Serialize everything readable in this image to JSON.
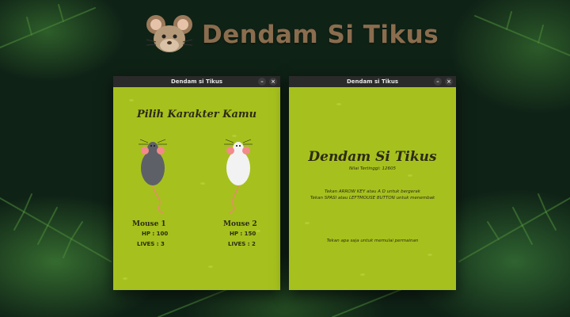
{
  "header": {
    "title": "Dendam Si Tikus",
    "logo": "mouse-head-icon"
  },
  "left_window": {
    "title": "Dendam si Tikus",
    "minimize_glyph": "–",
    "close_glyph": "×",
    "heading": "Pilih Karakter Kamu",
    "characters": [
      {
        "name": "Mouse 1",
        "hp": "HP : 100",
        "lives": "LIVES : 3",
        "body_color": "#5e6068"
      },
      {
        "name": "Mouse 2",
        "hp": "HP : 150",
        "lives": "LIVES : 2",
        "body_color": "#f2f2f2"
      }
    ]
  },
  "right_window": {
    "title": "Dendam si Tikus",
    "minimize_glyph": "–",
    "close_glyph": "×",
    "game_title": "Dendam Si Tikus",
    "highscore": "Nilai Tertinggi: 12605",
    "instruction_1": "Tekan ARROW KEY atau A D untuk bergerak",
    "instruction_2": "Tekan SPASI atau LEFTMOUSE BUTTON untuk menembak",
    "instruction_3": "Tekan apa saja untuk memulai permainan"
  },
  "colors": {
    "game_bg": "#a6c11d",
    "text_dark": "#2d2a14",
    "title_brown": "#8a6d4e",
    "titlebar": "#2a2a2a"
  }
}
